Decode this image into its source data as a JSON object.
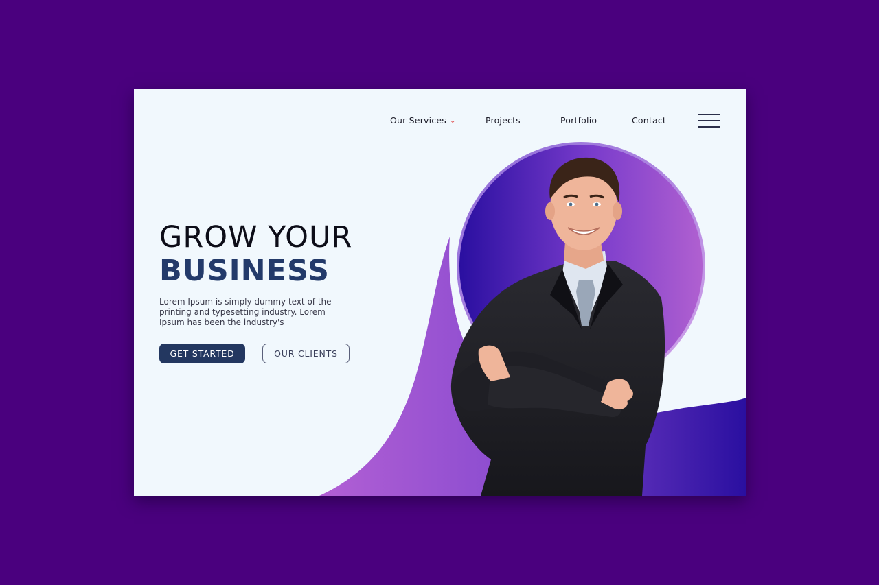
{
  "nav": {
    "items": [
      {
        "label": "Our Services",
        "has_dropdown": true
      },
      {
        "label": "Projects",
        "has_dropdown": false
      },
      {
        "label": "Portfolio",
        "has_dropdown": false
      },
      {
        "label": "Contact",
        "has_dropdown": false
      }
    ],
    "dropdown_icon": "chevron-down-icon",
    "menu_icon": "hamburger-menu-icon"
  },
  "hero": {
    "title_line1": "GROW YOUR",
    "title_line2": "BUSINESS",
    "description": "Lorem Ipsum is simply dummy text of the printing and typesetting industry. Lorem Ipsum has been the industry's",
    "primary_button": "GET STARTED",
    "secondary_button": "OUR CLIENTS"
  },
  "colors": {
    "outer_background": "#4a007e",
    "card_background": "#f1f8fd",
    "accent_navy": "#233a6a",
    "gradient_blue": "#2a0fa0",
    "gradient_purple": "#b25fd4",
    "dropdown_accent": "#e04848"
  }
}
